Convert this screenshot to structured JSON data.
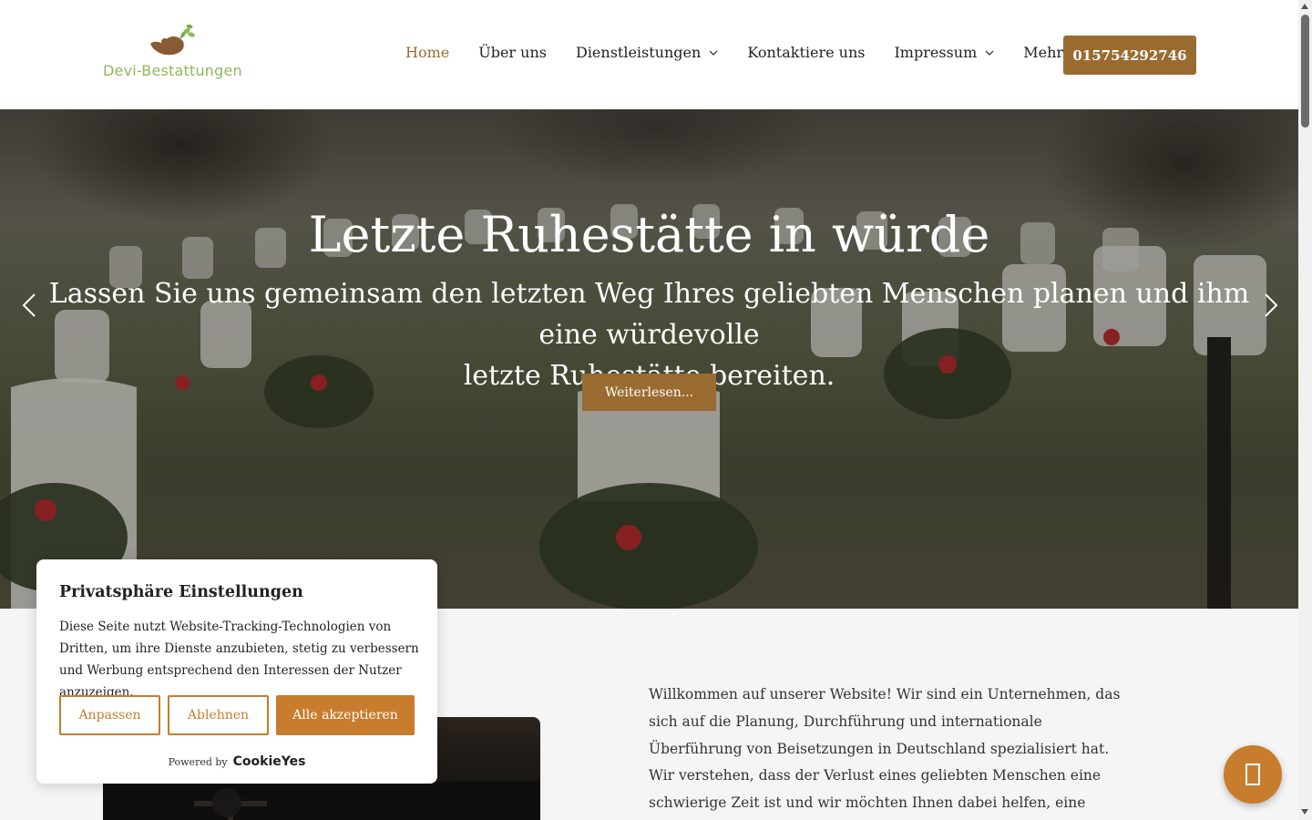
{
  "header": {
    "brand": "Devi-Bestattungen",
    "logo_icon": "dove-with-leaves-icon",
    "nav": [
      {
        "label": "Home",
        "active": true,
        "dropdown": false
      },
      {
        "label": "Über uns",
        "active": false,
        "dropdown": false
      },
      {
        "label": "Dienstleistungen",
        "active": false,
        "dropdown": true
      },
      {
        "label": "Kontaktiere uns",
        "active": false,
        "dropdown": false
      },
      {
        "label": "Impressum",
        "active": false,
        "dropdown": true
      },
      {
        "label": "Mehr",
        "active": false,
        "dropdown": true
      }
    ],
    "phone": "015754292746"
  },
  "hero": {
    "title": "Letzte Ruhestätte in würde",
    "subtitle_line1": "Lassen Sie uns gemeinsam den letzten Weg Ihres geliebten Menschen planen und ihm eine würdevolle",
    "subtitle_line2": "letzte Ruhestätte bereiten.",
    "button": "Weiterlesen..."
  },
  "intro": {
    "text": "Willkommen auf unserer Website! Wir sind ein Unternehmen, das sich auf die Planung, Durchführung und internationale Überführung von Beisetzungen in Deutschland spezialisiert hat. Wir verstehen, dass der Verlust eines geliebten Menschen eine schwierige Zeit ist und wir möchten Ihnen dabei helfen, eine würdige Verabschiedung zu gestalten."
  },
  "cookie": {
    "title": "Privatsphäre Einstellungen",
    "body": "Diese Seite nutzt Website-Tracking-Technologien von Dritten, um ihre Dienste anzubieten, stetig zu verbessern und Werbung entsprechend den Interessen der Nutzer anzuzeigen.",
    "customize": "Anpassen",
    "reject": "Ablehnen",
    "accept_all": "Alle akzeptieren",
    "powered_by": "Powered by",
    "provider": "CookieYes"
  },
  "colors": {
    "accent": "#9a6b31",
    "cookie_accent": "#c77d2d",
    "brand_green": "#8fb85a"
  }
}
